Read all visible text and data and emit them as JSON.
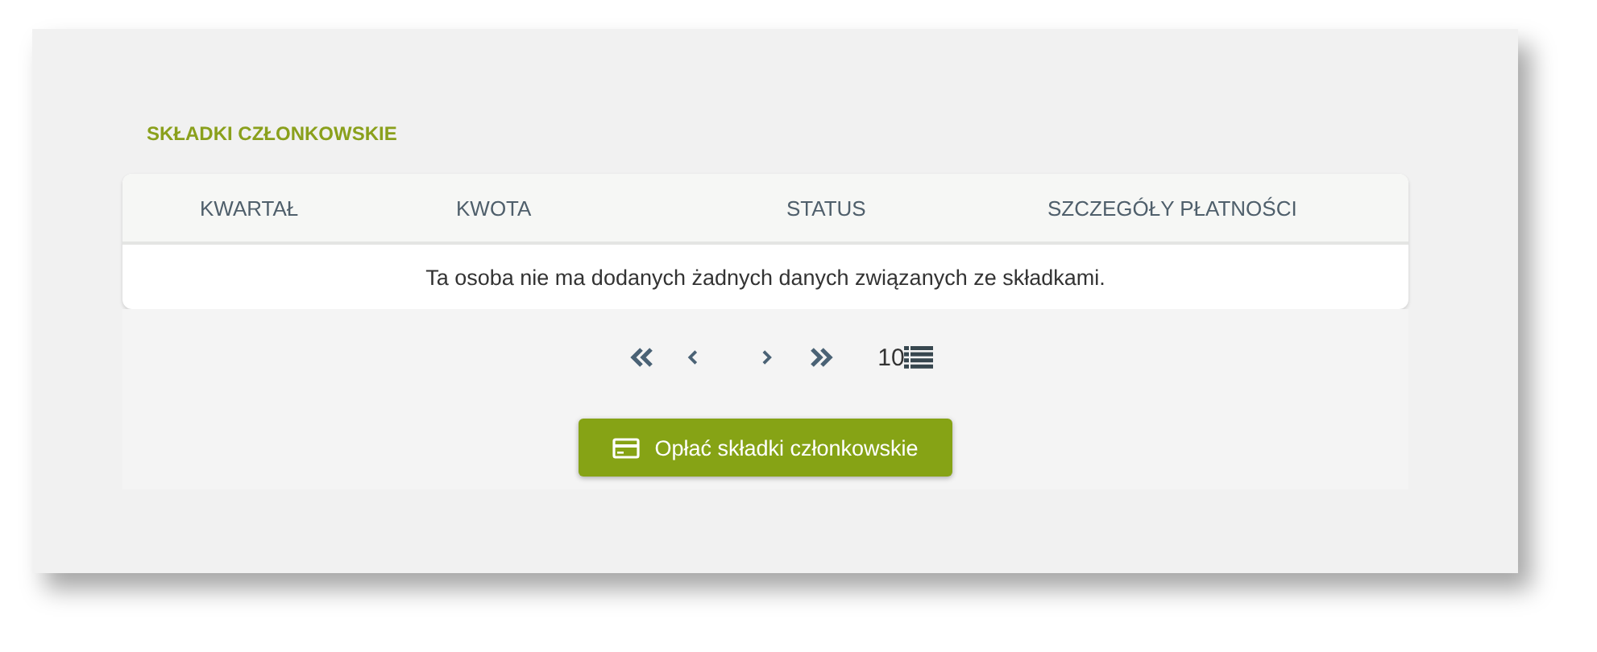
{
  "section_title": "SKŁADKI CZŁONKOWSKIE",
  "table": {
    "columns": [
      "KWARTAŁ",
      "KWOTA",
      "STATUS",
      "SZCZEGÓŁY PŁATNOŚCI"
    ],
    "empty_message": "Ta osoba nie ma dodanych żadnych danych związanych ze składkami."
  },
  "pagination": {
    "buttons": [
      {
        "kind": "first",
        "disabled": false
      },
      {
        "kind": "prev",
        "disabled": false
      },
      {
        "kind": "next",
        "disabled": false
      },
      {
        "kind": "last",
        "disabled": false
      }
    ],
    "page_size": "10"
  },
  "pay_button": {
    "label": "Opłać składki członkowskie"
  }
}
